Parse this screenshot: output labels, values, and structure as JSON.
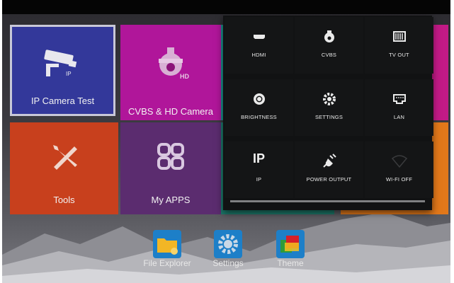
{
  "tiles": [
    {
      "label": "IP Camera Test",
      "icon": "ip-camera-icon",
      "color": "#33389a",
      "selected": true
    },
    {
      "label": "CVBS & HD Camera",
      "icon": "ptz-camera-icon",
      "color": "#b0169a"
    },
    {
      "label": "Tools",
      "icon": "tools-icon",
      "color": "#c8401d"
    },
    {
      "label": "My APPS",
      "icon": "apps-icon",
      "color": "#5b2c6f"
    }
  ],
  "quick_settings": [
    {
      "label": "HDMI",
      "icon": "hdmi-icon"
    },
    {
      "label": "CVBS",
      "icon": "cvbs-camera-icon"
    },
    {
      "label": "TV OUT",
      "icon": "tv-out-icon"
    },
    {
      "label": "BRIGHTNESS",
      "icon": "brightness-icon"
    },
    {
      "label": "SETTINGS",
      "icon": "gear-icon"
    },
    {
      "label": "LAN",
      "icon": "lan-icon"
    },
    {
      "label": "IP",
      "icon": "ip-text-icon"
    },
    {
      "label": "POWER OUTPUT",
      "icon": "power-plug-icon"
    },
    {
      "label": "WI-FI OFF",
      "icon": "wifi-off-icon"
    }
  ],
  "dock": [
    {
      "label": "File Explorer",
      "icon": "folder-icon"
    },
    {
      "label": "Settings",
      "icon": "gear-icon"
    },
    {
      "label": "Theme",
      "icon": "theme-icon"
    }
  ],
  "icon_text": {
    "ip": "IP",
    "hd": "HD",
    "ip_big": "IP"
  }
}
